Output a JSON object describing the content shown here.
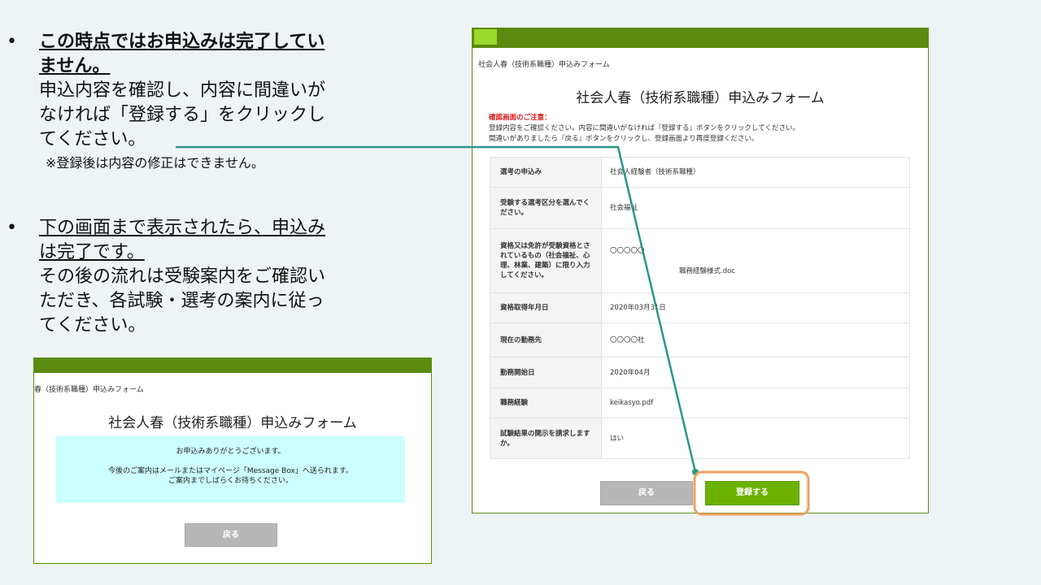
{
  "slide": {
    "bullet_char": "•",
    "point1": {
      "head_lines": [
        "この時点ではお申込みは完了してい",
        "ません。"
      ],
      "body_lines": [
        "申込内容を確認し、内容に間違いが",
        "なければ「登録する」をクリックし",
        "てください。"
      ],
      "note": "※登録後は内容の修正はできません。"
    },
    "point2": {
      "head_lines": [
        "下の画面まで表示されたら、申込み",
        "は完了です。"
      ],
      "body_lines": [
        "その後の流れは受験案内をご確認い",
        "ただき、各試験・選考の案内に従っ",
        "てください。"
      ]
    }
  },
  "confirm_window": {
    "breadcrumb": "社会人春（技術系職種）申込みフォーム",
    "title": "社会人春（技術系職種）申込みフォーム",
    "caution_head": "確認画面のご注意：",
    "caution_lines": [
      "登録内容をご確認ください。内容に間違いがなければ『登録する』ボタンをクリックしてください。",
      "間違いがありましたら『戻る』ボタンをクリックし、登録画面より再度登録ください。"
    ],
    "rows": [
      {
        "label": "選考の申込み",
        "value": "社会人経験者（技術系職種）"
      },
      {
        "label": "受験する選考区分を選んでください。",
        "value": "社会福祉"
      },
      {
        "label": "資格又は免許が受験資格とされているもの（社会福祉、心理、林業、建築）に限り入力してください。",
        "value": "〇〇〇〇〇",
        "sub": "職務経験様式.doc"
      },
      {
        "label": "資格取得年月日",
        "value": "2020年03月31日"
      },
      {
        "label": "現在の勤務先",
        "value": "〇〇〇〇社"
      },
      {
        "label": "勤務開始日",
        "value": "2020年04月"
      },
      {
        "label": "職務経験",
        "value": "keikasyo.pdf"
      },
      {
        "label": "試験結果の開示を請求しますか。",
        "value": "はい"
      }
    ],
    "back_label": "戻る",
    "register_label": "登録する"
  },
  "complete_window": {
    "breadcrumb": "春（技術系職種）申込みフォーム",
    "title": "社会人春（技術系職種）申込みフォーム",
    "notice_lines": [
      "お申込みありがとうございます。",
      "今後のご案内はメールまたはマイページ「Message Box」へ送られます。",
      "ご案内までしばらくお待ちください。"
    ],
    "back_label": "戻る"
  },
  "colors": {
    "window_bar": "#5b8a0f",
    "register_button": "#6db200",
    "connector_line": "#2b9688",
    "highlight_box": "#f0a060",
    "notice_bg": "#ccfdff"
  }
}
